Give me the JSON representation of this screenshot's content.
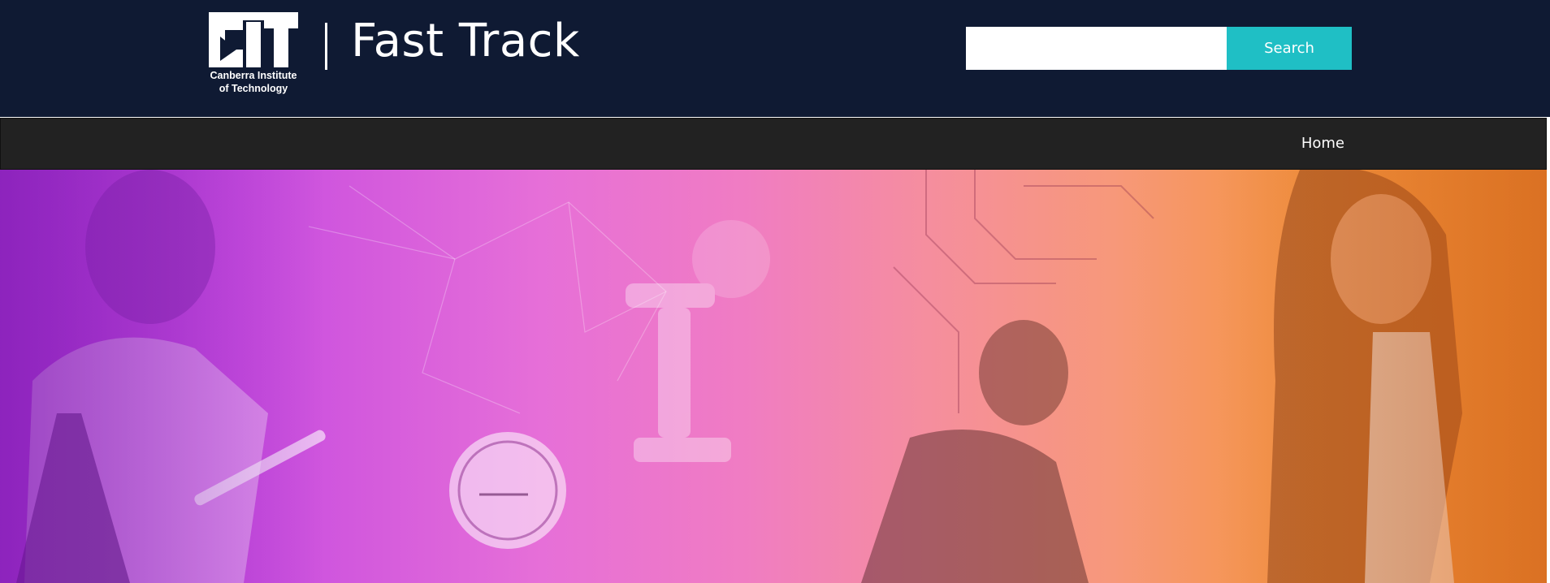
{
  "logo": {
    "line1": "Canberra Institute",
    "line2": "of Technology"
  },
  "header": {
    "title": "Fast Track"
  },
  "search": {
    "placeholder": "",
    "value": "",
    "button_label": "Search"
  },
  "nav": {
    "items": [
      {
        "label": "Home"
      }
    ]
  },
  "colors": {
    "header_bg": "#0f1a33",
    "nav_bg": "#222222",
    "accent": "#1fbfc5",
    "hero_start": "#a42fd6",
    "hero_mid": "#f07cc3",
    "hero_end": "#f08a2a"
  }
}
